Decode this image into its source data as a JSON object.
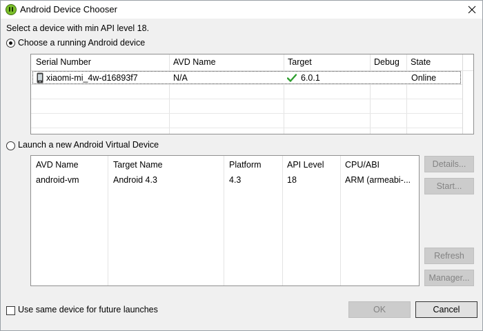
{
  "window": {
    "title": "Android Device Chooser",
    "close_glyph": "✕"
  },
  "instruction": "Select a device with min API level 18.",
  "running_section": {
    "radio_label": "Choose a running Android device",
    "selected": true,
    "columns": [
      "Serial Number",
      "AVD Name",
      "Target",
      "Debug",
      "State"
    ],
    "rows": [
      {
        "serial": "xiaomi-mi_4w-d16893f7",
        "avd_name": "N/A",
        "target": "6.0.1",
        "debug": "",
        "state": "Online",
        "device_icon": "phone-icon",
        "target_icon": "checkmark-icon"
      }
    ]
  },
  "virtual_section": {
    "radio_label": "Launch a new Android Virtual Device",
    "selected": false,
    "columns": [
      "AVD Name",
      "Target Name",
      "Platform",
      "API Level",
      "CPU/ABI"
    ],
    "rows": [
      {
        "avd_name": "android-vm",
        "target_name": "Android 4.3",
        "platform": "4.3",
        "api_level": "18",
        "cpu_abi": "ARM (armeabi-..."
      }
    ],
    "buttons": {
      "details": "Details...",
      "start": "Start...",
      "refresh": "Refresh",
      "manager": "Manager..."
    }
  },
  "footer": {
    "checkbox_label": "Use same device for future launches",
    "checked": false,
    "ok_label": "OK",
    "cancel_label": "Cancel"
  },
  "colors": {
    "accent_check": "#2e9e2e",
    "icon_green": "#7bbf2a"
  }
}
